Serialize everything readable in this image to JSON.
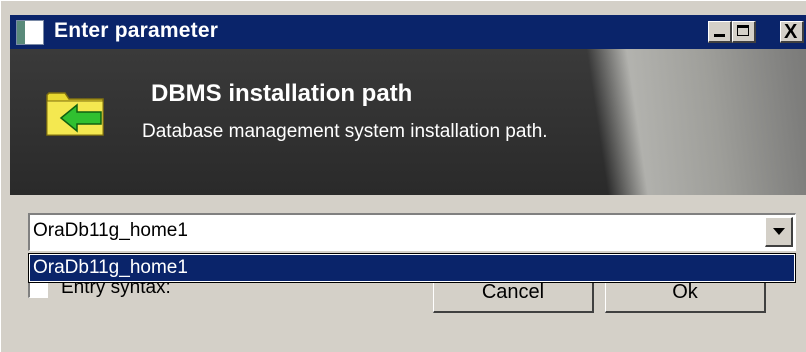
{
  "window": {
    "title": "Enter parameter",
    "controls": [
      "minimize",
      "maximize",
      "close"
    ],
    "close_label": "X"
  },
  "banner": {
    "icon": "folder-arrow-icon",
    "title": "DBMS installation path",
    "subtitle": "Database management system installation path."
  },
  "combo": {
    "selected_value": "OraDb11g_home1",
    "options": [
      "OraDb11g_home1"
    ],
    "highlighted_option": "OraDb11g_home1"
  },
  "checkbox": {
    "label": "Entry syntax:",
    "checked": false
  },
  "buttons": {
    "cancel": "Cancel",
    "ok": "Ok"
  },
  "colors": {
    "titlebar": "#0a246a",
    "banner": "#2e2e2e",
    "dialog_face": "#d4d0c8",
    "selection": "#0a246a",
    "folder_yellow": "#f0e040",
    "arrow_green": "#30c030"
  }
}
